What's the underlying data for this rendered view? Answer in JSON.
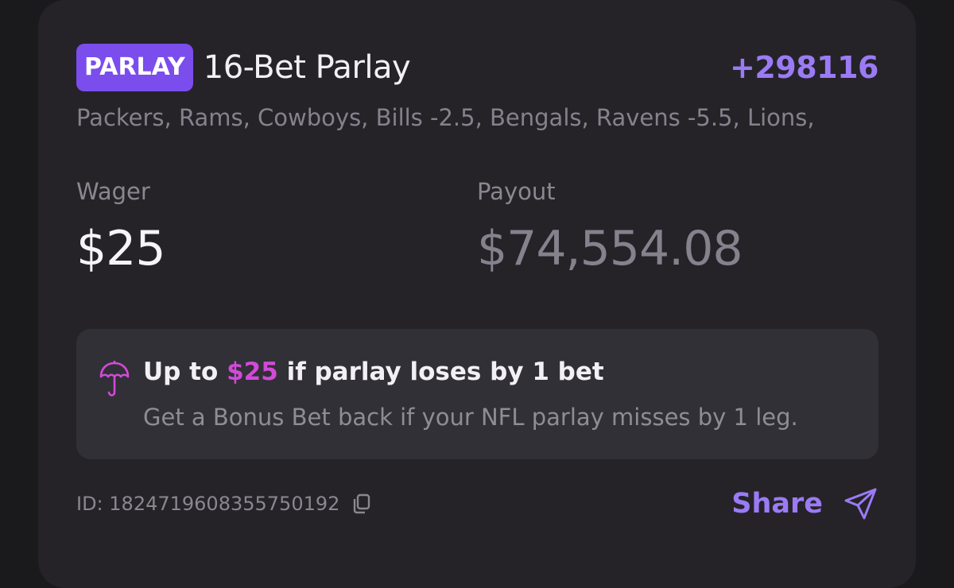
{
  "bet": {
    "badge": "PARLAY",
    "title": "16-Bet Parlay",
    "odds": "+298116",
    "legs": "Packers, Rams, Cowboys, Bills -2.5, Bengals, Ravens -5.5, Lions,"
  },
  "wager": {
    "label": "Wager",
    "value": "$25"
  },
  "payout": {
    "label": "Payout",
    "value": "$74,554.08"
  },
  "promo": {
    "icon": "umbrella-icon",
    "title_prefix": "Up to ",
    "title_amount": "$25",
    "title_suffix": " if parlay loses by 1 bet",
    "description": "Get a Bonus Bet back if your NFL parlay misses by 1 leg."
  },
  "footer": {
    "bet_id": "ID: 1824719608355750192",
    "copy_icon": "copy-icon",
    "share_label": "Share",
    "share_icon": "send-icon"
  },
  "colors": {
    "accent_purple": "#7a4dec",
    "odds_purple": "#9b7bf5",
    "promo_magenta": "#d24ad8",
    "card_background": "#252328",
    "page_background": "#1a191c"
  }
}
